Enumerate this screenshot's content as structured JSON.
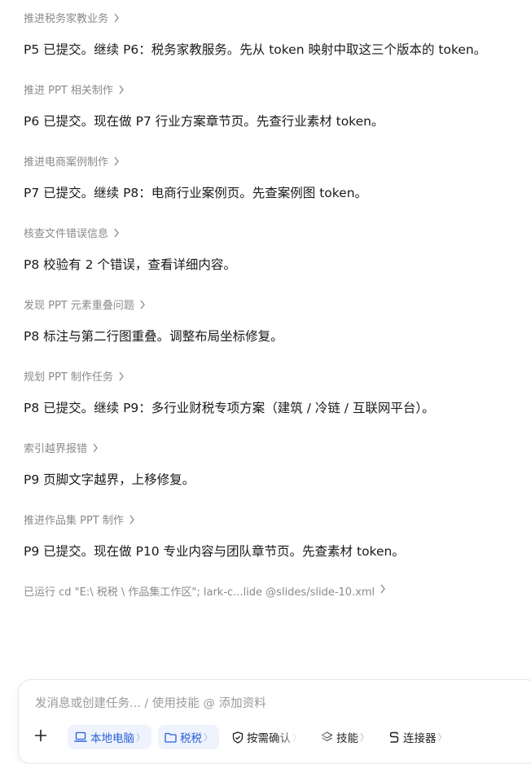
{
  "steps": [
    {
      "title": "推进税务家教业务",
      "message": "P5 已提交。继续 P6：税务家教服务。先从 token 映射中取这三个版本的 token。"
    },
    {
      "title": "推进 PPT 相关制作",
      "message": "P6 已提交。现在做 P7 行业方案章节页。先查行业素材 token。"
    },
    {
      "title": "推进电商案例制作",
      "message": "P7 已提交。继续 P8：电商行业案例页。先查案例图 token。"
    },
    {
      "title": "核查文件错误信息",
      "message": "P8 校验有 2 个错误，查看详细内容。"
    },
    {
      "title": "发现 PPT 元素重叠问题",
      "message": "P8 标注与第二行图重叠。调整布局坐标修复。"
    },
    {
      "title": "规划 PPT 制作任务",
      "message": "P8 已提交。继续 P9：多行业财税专项方案（建筑 / 冷链 / 互联网平台）。"
    },
    {
      "title": "索引越界报错",
      "message": "P9 页脚文字越界，上移修复。"
    },
    {
      "title": "推进作品集 PPT 制作",
      "message": "P9 已提交。现在做 P10 专业内容与团队章节页。先查素材 token。"
    }
  ],
  "run_line": "已运行 cd \"E:\\ 税税 \\ 作品集工作区\"; lark-c...lide @slides/slide-10.xml",
  "composer": {
    "placeholder": "发消息或创建任务... / 使用技能 @ 添加资料",
    "value": ""
  },
  "toolbar": {
    "plus_icon": "plus-icon",
    "chips": [
      {
        "label": "本地电脑",
        "icon": "laptop-icon",
        "style": "blue"
      },
      {
        "label": "税税",
        "icon": "folder-icon",
        "style": "blue"
      },
      {
        "label": "按需确认",
        "icon": "shield-check-icon",
        "style": "plain"
      },
      {
        "label": "技能",
        "icon": "skills-icon",
        "style": "plain"
      },
      {
        "label": "连接器",
        "icon": "connector-icon",
        "style": "plain"
      }
    ]
  },
  "colors": {
    "accent": "#2b5fd9",
    "chip_bg": "#eef3fd",
    "muted_text": "#8a8a8a"
  }
}
